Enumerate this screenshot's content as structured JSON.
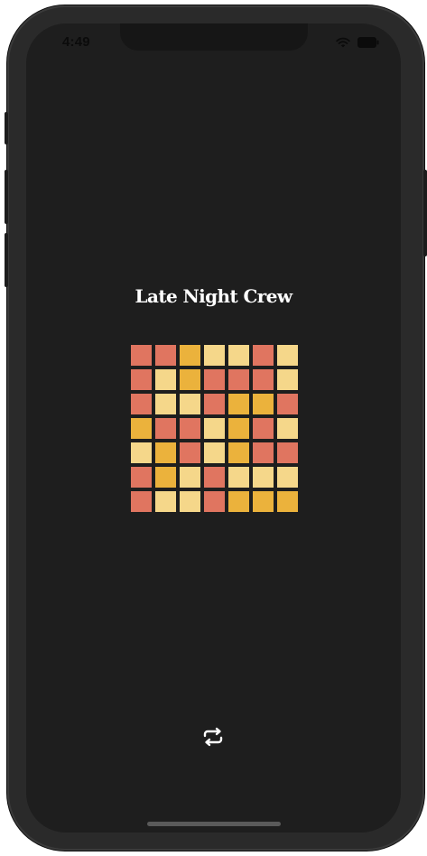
{
  "status_bar": {
    "time": "4:49",
    "icons": [
      "wifi-icon",
      "battery-icon"
    ]
  },
  "main": {
    "title": "Late Night Crew"
  },
  "palette": {
    "coral": "#e07560",
    "gold": "#ebb23c",
    "cream": "#f5d78a"
  },
  "grid": {
    "rows": [
      [
        "coral",
        "coral",
        "gold",
        "cream",
        "cream",
        "coral",
        "cream"
      ],
      [
        "coral",
        "cream",
        "gold",
        "coral",
        "coral",
        "coral",
        "cream"
      ],
      [
        "coral",
        "cream",
        "cream",
        "coral",
        "gold",
        "gold",
        "coral"
      ],
      [
        "gold",
        "coral",
        "coral",
        "cream",
        "gold",
        "coral",
        "cream"
      ],
      [
        "cream",
        "gold",
        "coral",
        "cream",
        "gold",
        "coral",
        "coral"
      ],
      [
        "coral",
        "gold",
        "cream",
        "coral",
        "cream",
        "cream",
        "cream"
      ],
      [
        "coral",
        "cream",
        "cream",
        "coral",
        "gold",
        "gold",
        "gold"
      ]
    ]
  },
  "controls": {
    "repeat_icon": "repeat-icon"
  }
}
